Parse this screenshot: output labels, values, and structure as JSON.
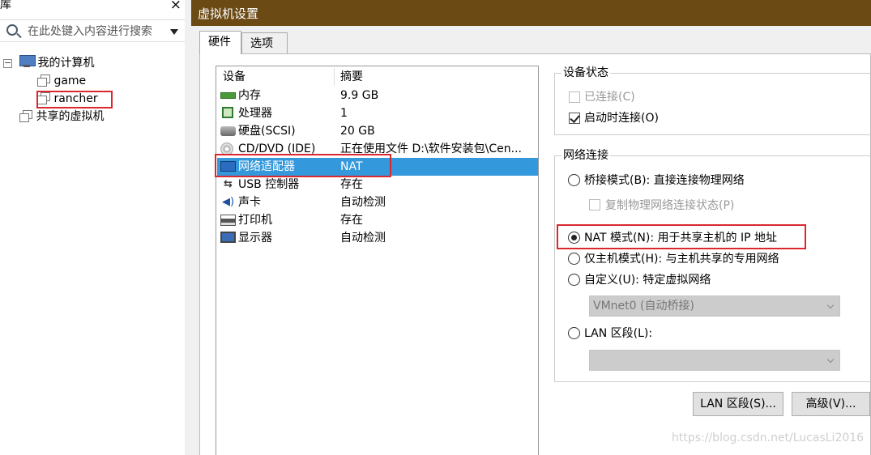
{
  "library": {
    "title": "库",
    "close": "×",
    "search_placeholder": "在此处键入内容进行搜索",
    "tree": {
      "my_computer": "我的计算机",
      "vms": [
        "game",
        "rancher"
      ],
      "shared": "共享的虚拟机"
    }
  },
  "dialog": {
    "title": "虚拟机设置",
    "tabs": [
      "硬件",
      "选项"
    ],
    "devices": {
      "headers": {
        "device": "设备",
        "summary": "摘要"
      },
      "rows": [
        {
          "name": "内存",
          "summary": "9.9 GB",
          "icon": "memory-icon"
        },
        {
          "name": "处理器",
          "summary": "1",
          "icon": "processor-icon"
        },
        {
          "name": "硬盘(SCSI)",
          "summary": "20 GB",
          "icon": "hard-disk-icon"
        },
        {
          "name": "CD/DVD (IDE)",
          "summary": "正在使用文件 D:\\软件安装包\\Cen...",
          "icon": "cd-dvd-icon"
        },
        {
          "name": "网络适配器",
          "summary": "NAT",
          "icon": "network-adapter-icon"
        },
        {
          "name": "USB 控制器",
          "summary": "存在",
          "icon": "usb-icon"
        },
        {
          "name": "声卡",
          "summary": "自动检测",
          "icon": "sound-card-icon"
        },
        {
          "name": "打印机",
          "summary": "存在",
          "icon": "printer-icon"
        },
        {
          "name": "显示器",
          "summary": "自动检测",
          "icon": "display-icon"
        }
      ]
    },
    "device_status": {
      "title": "设备状态",
      "connected": "已连接(C)",
      "connect_at_power_on": "启动时连接(O)"
    },
    "network": {
      "title": "网络连接",
      "bridged": "桥接模式(B): 直接连接物理网络",
      "replicate": "复制物理网络连接状态(P)",
      "nat": "NAT 模式(N): 用于共享主机的 IP 地址",
      "host_only": "仅主机模式(H): 与主机共享的专用网络",
      "custom": "自定义(U): 特定虚拟网络",
      "custom_value": "VMnet0 (自动桥接)",
      "lan_segment": "LAN 区段(L):",
      "lan_segment_value": ""
    },
    "buttons": {
      "lan_segments": "LAN 区段(S)...",
      "advanced": "高级(V)..."
    }
  },
  "watermark": "https://blog.csdn.net/LucasLi2016",
  "colors": {
    "titlebar": "#6b4a14",
    "selection": "#3398dc",
    "highlight_box": "#d9292f"
  }
}
